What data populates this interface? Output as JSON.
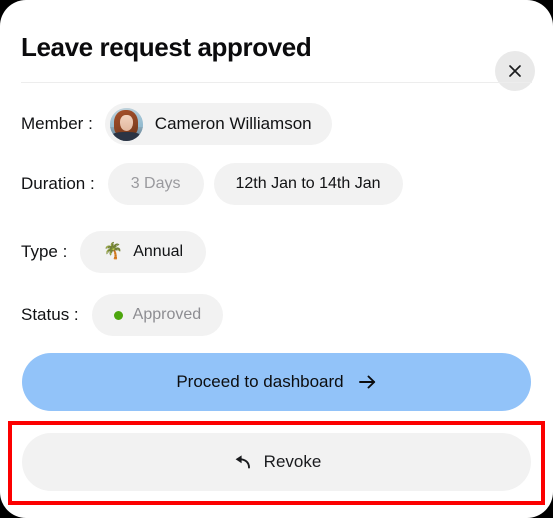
{
  "dialog": {
    "title": "Leave request approved",
    "close_icon": "close-icon"
  },
  "details": [
    {
      "label": "Member :",
      "value": "Cameron Williamson",
      "icon": "avatar-photo"
    },
    {
      "label": "Duration :",
      "value": "3 Days",
      "value2": "12th Jan to 14th Jan"
    },
    {
      "label": "Type :",
      "value": "Annual",
      "icon": "palm-tree-emoji",
      "emoji": "🌴"
    },
    {
      "label": "Status :",
      "value": "Approved",
      "icon": "green-status-dot",
      "dot_color": "#4da60e"
    }
  ],
  "member_row": {
    "label": "Member :",
    "name": "Cameron Williamson"
  },
  "duration_row": {
    "label": "Duration :",
    "days": "3 Days",
    "dates": "12th Jan to 14th Jan"
  },
  "type_row": {
    "label": "Type :",
    "emoji": "🌴",
    "value": "Annual"
  },
  "status_row": {
    "label": "Status :",
    "value": "Approved"
  },
  "actions": {
    "primary_label": "Proceed to dashboard",
    "primary_icon": "arrow-right-icon",
    "secondary_label": "Revoke",
    "secondary_icon": "undo-arrow-icon"
  },
  "colors": {
    "card_background": "#ffffff",
    "page_background": "#000000",
    "pill_background": "#f2f2f2",
    "primary_button": "#92c3f9",
    "secondary_button": "#f2f2f2",
    "status_green": "#4da60e",
    "muted_text": "#9a9a9e",
    "highlight_border": "#fc0000"
  }
}
